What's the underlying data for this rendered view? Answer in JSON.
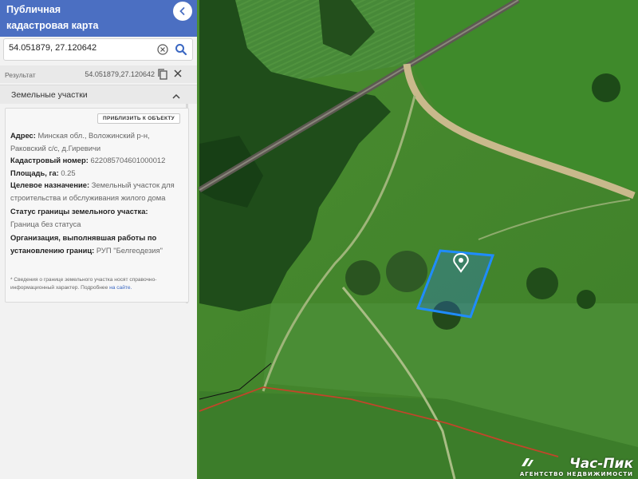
{
  "header": {
    "title": "Публичная\nкадастровая карта",
    "back_icon": "chevron-left-icon"
  },
  "search": {
    "value": "54.051879, 27.120642",
    "clear_icon": "clear-circle-icon",
    "search_icon": "search-icon"
  },
  "result": {
    "label": "Результат",
    "coords": "54.051879,27.120642",
    "copy_icon": "copy-icon",
    "close_icon": "close-icon"
  },
  "section": {
    "label": "Земельные участки",
    "toggle_icon": "chevron-up-icon"
  },
  "card": {
    "zoom_button": "ПРИБЛИЗИТЬ К ОБЪЕКТУ",
    "address_label": "Адрес:",
    "address_value": "Минская обл., Воложинский р-н, Раковский с/с, д.Гиревичи",
    "cadastral_label": "Кадастровый номер:",
    "cadastral_value": "622085704601000012",
    "area_label": "Площадь, га:",
    "area_value": "0.25",
    "purpose_label": "Целевое назначение:",
    "purpose_value": "Земельный участок для строительства и обслуживания жилого дома",
    "border_label": "Статус границы земельного участка:",
    "border_value": "Граница без статуса",
    "org_label": "Организация, выполнявшая работы по установлению границ:",
    "org_value": "РУП \"Белгеодезия\"",
    "note_text": "* Сведения о границе земельного участка носят справочно-информационный характер. Подробнее",
    "note_link": "на сайте."
  },
  "watermark": {
    "brand": "Час-Пик",
    "subtitle": "АГЕНТСТВО НЕДВИЖИМОСТИ"
  },
  "colors": {
    "header": "#4b6fc2",
    "parcel_outline": "#1f8cff",
    "marker": "#2f86ff",
    "border_line": "#c0462a"
  }
}
